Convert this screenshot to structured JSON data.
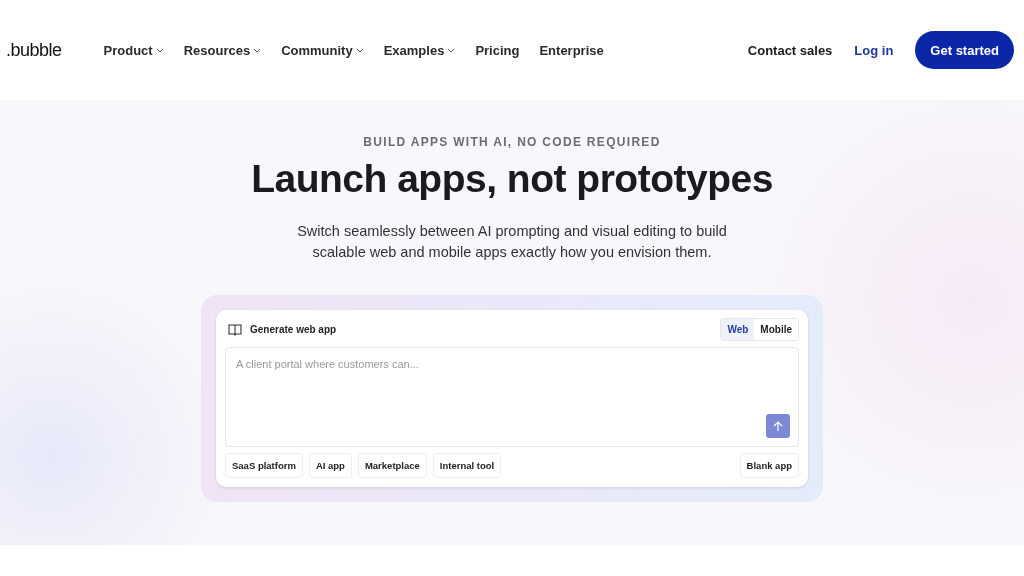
{
  "header": {
    "logo": ".bubble",
    "nav": [
      {
        "label": "Product",
        "dropdown": true
      },
      {
        "label": "Resources",
        "dropdown": true
      },
      {
        "label": "Community",
        "dropdown": true
      },
      {
        "label": "Examples",
        "dropdown": true
      },
      {
        "label": "Pricing",
        "dropdown": false
      },
      {
        "label": "Enterprise",
        "dropdown": false
      }
    ],
    "contact": "Contact sales",
    "login": "Log in",
    "cta": "Get started"
  },
  "hero": {
    "eyebrow": "BUILD APPS WITH AI, NO CODE REQUIRED",
    "title": "Launch apps, not prototypes",
    "subtitle": "Switch seamlessly between AI prompting and visual editing to build scalable web and mobile apps exactly how you envision them."
  },
  "generator": {
    "label": "Generate web app",
    "modes": [
      {
        "label": "Web",
        "selected": true
      },
      {
        "label": "Mobile",
        "selected": false
      }
    ],
    "placeholder": "A client portal where customers can...",
    "suggestions": [
      "SaaS platform",
      "AI app",
      "Marketplace",
      "Internal tool"
    ],
    "blank": "Blank app"
  }
}
